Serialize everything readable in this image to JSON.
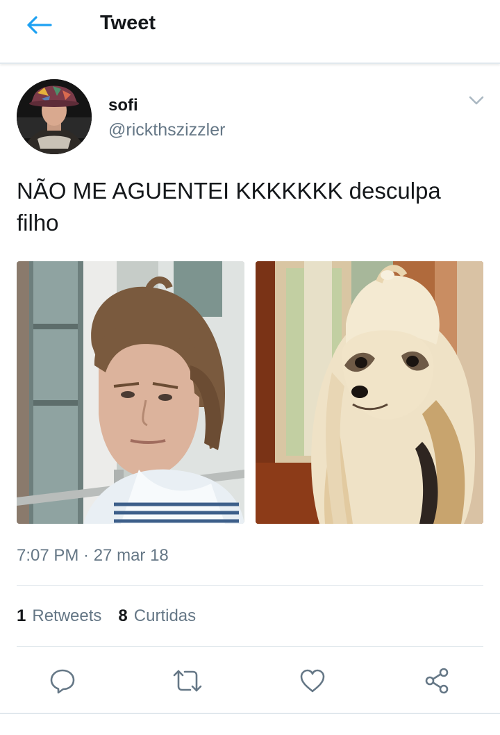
{
  "header": {
    "title": "Tweet",
    "back_icon": "arrow-left-icon"
  },
  "colors": {
    "accent": "#1da1f2",
    "secondary_text": "#657786",
    "icon_gray": "#657786"
  },
  "author": {
    "display_name": "sofi",
    "username": "@rickthszizzler",
    "menu_icon": "chevron-down-icon"
  },
  "tweet": {
    "text": "NÃO ME AGUENTEI KKKKKKK desculpa filho",
    "timestamp": "7:07 PM · 27 mar 18",
    "media": [
      {
        "description": "photo-young-man-messy-hair"
      },
      {
        "description": "photo-shih-tzu-dog"
      }
    ]
  },
  "stats": {
    "retweets_count": "1",
    "retweets_label": "Retweets",
    "likes_count": "8",
    "likes_label": "Curtidas"
  },
  "actions": [
    "reply-icon",
    "retweet-icon",
    "like-icon",
    "share-icon"
  ]
}
